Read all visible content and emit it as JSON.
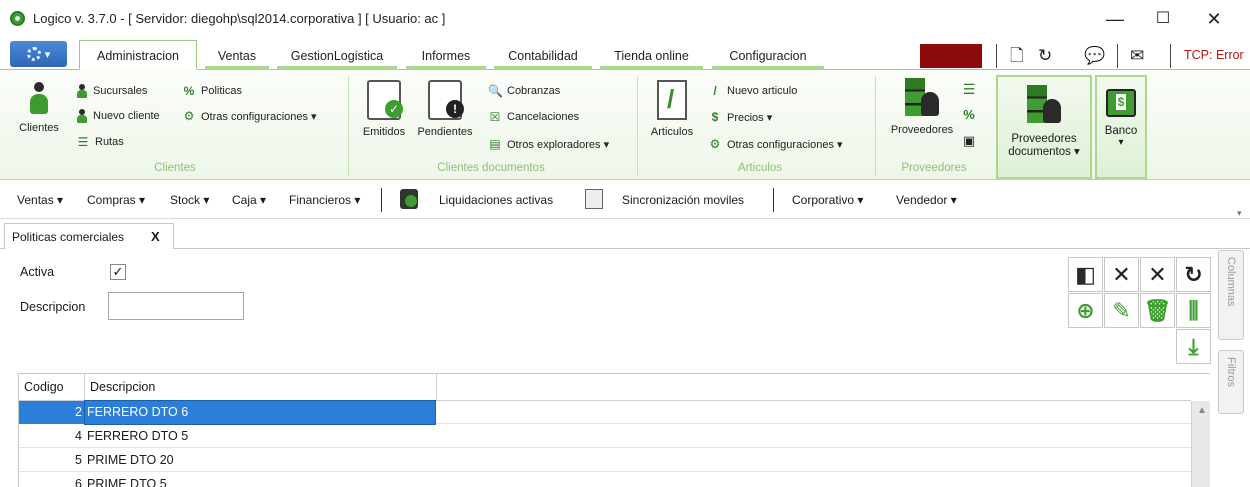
{
  "window": {
    "title": "Logico v. 3.7.0  -  [ Servidor: diegohp\\sql2014.corporativa ] [ Usuario: ac ]",
    "minimize": "—",
    "maximize": "☐",
    "close": "✕"
  },
  "tabs": [
    {
      "label": "Administracion",
      "active": true
    },
    {
      "label": "Ventas"
    },
    {
      "label": "GestionLogistica"
    },
    {
      "label": "Informes"
    },
    {
      "label": "Contabilidad"
    },
    {
      "label": "Tienda online"
    },
    {
      "label": "Configuracion"
    }
  ],
  "status": {
    "tcp": "TCP: Error",
    "indicator_color": "#8c0a0a"
  },
  "ribbon": {
    "clientes": {
      "big": "Clientes",
      "sucursales": "Sucursales",
      "nuevo_cliente": "Nuevo cliente",
      "rutas": "Rutas",
      "politicas": "Politicas",
      "otras_config": "Otras configuraciones ▾",
      "group": "Clientes"
    },
    "clientes_docs": {
      "emitidos": "Emitidos",
      "pendientes": "Pendientes",
      "cobranzas": "Cobranzas",
      "cancelaciones": "Cancelaciones",
      "otros_exploradores": "Otros exploradores ▾",
      "group": "Clientes documentos"
    },
    "articulos": {
      "big": "Articulos",
      "nuevo_articulo": "Nuevo articulo",
      "precios": "Precios ▾",
      "otras_config": "Otras configuraciones ▾",
      "group": "Articulos"
    },
    "proveedores": {
      "big": "Proveedores",
      "group": "Proveedores"
    },
    "prov_docs": {
      "line1": "Proveedores",
      "line2": "documentos ▾"
    },
    "banco": {
      "label": "Banco",
      "arrow": "▾"
    }
  },
  "toolbar2": {
    "ventas": "Ventas ▾",
    "compras": "Compras ▾",
    "stock": "Stock ▾",
    "caja": "Caja ▾",
    "financieros": "Financieros ▾",
    "liquidaciones": "Liquidaciones activas",
    "sincronizacion": "Sincronización moviles",
    "corporativo": "Corporativo ▾",
    "vendedor": "Vendedor ▾"
  },
  "doc_tab": {
    "label": "Politicas comerciales",
    "close": "X"
  },
  "form": {
    "activa_label": "Activa",
    "activa_checked": true,
    "descripcion_label": "Descripcion",
    "descripcion_value": ""
  },
  "side_tabs": {
    "columnas": "Columnas",
    "filtros": "Filtros"
  },
  "grid": {
    "columns": [
      "Codigo",
      "Descripcion"
    ],
    "rows": [
      {
        "codigo": "2",
        "descripcion": "FERRERO DTO 6",
        "selected": true
      },
      {
        "codigo": "4",
        "descripcion": "FERRERO DTO 5"
      },
      {
        "codigo": "5",
        "descripcion": "PRIME DTO 20"
      },
      {
        "codigo": "6",
        "descripcion": "PRIME DTO 5"
      }
    ]
  },
  "colors": {
    "accent_green": "#3e9c30",
    "tab_underline": "#a9d88f",
    "selection_blue": "#2b7fd8"
  }
}
